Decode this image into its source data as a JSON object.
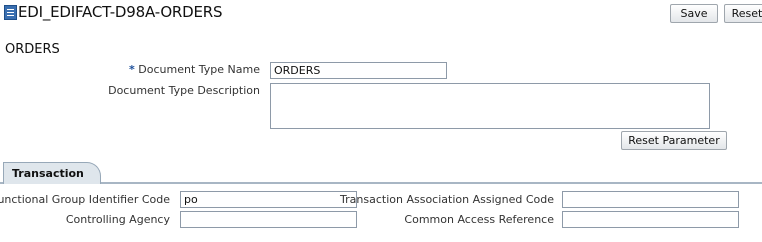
{
  "header": {
    "title": "EDI_EDIFACT-D98A-ORDERS",
    "save_label": "Save",
    "reset_label": "Reset"
  },
  "section": {
    "heading": "ORDERS"
  },
  "form": {
    "doc_type_name_label": "Document Type Name",
    "doc_type_name_value": "ORDERS",
    "doc_type_desc_label": "Document Type Description",
    "doc_type_desc_value": "",
    "reset_parameter_label": "Reset Parameter"
  },
  "transaction": {
    "tab_label": "Transaction",
    "functional_group_label": "Functional Group Identifier Code",
    "functional_group_value": "po",
    "controlling_agency_label": "Controlling Agency",
    "controlling_agency_value": "",
    "tx_assoc_code_label": "Transaction Association Assigned Code",
    "tx_assoc_code_value": "",
    "common_access_label": "Common Access Reference",
    "common_access_value": ""
  },
  "required_marker": "*",
  "colors": {
    "required_star": "#1b4e9a",
    "tab_bg": "#dfe6ec",
    "input_border": "#8e9aa8"
  }
}
